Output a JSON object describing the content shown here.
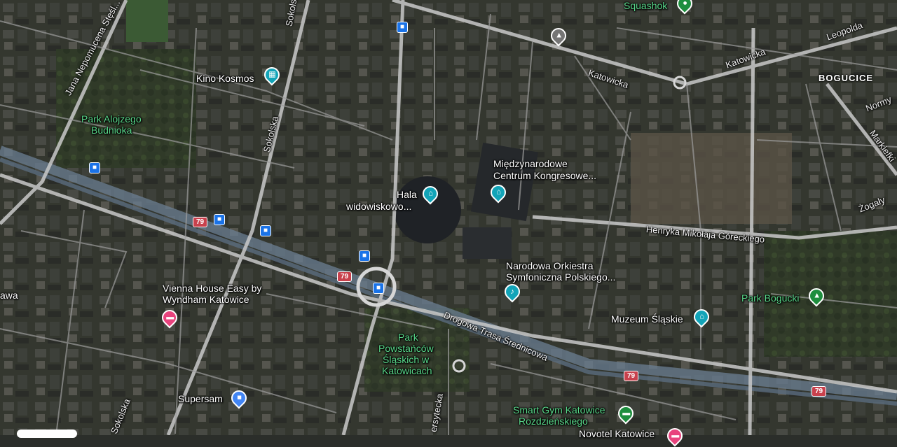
{
  "colors": {
    "teal_pin": "#12a4b8",
    "green_pin": "#1e8e3e",
    "pink_pin": "#e8437d",
    "gray_pin": "#757575",
    "blue_pin": "#4285f4",
    "route_shield": "#c8414d"
  },
  "pois": {
    "kino_kosmos": {
      "label": "Kino Kosmos",
      "icon": "film-icon"
    },
    "park_alojzego": {
      "label1": "Park Alojzego",
      "label2": "Budnioka"
    },
    "hala": {
      "label1": "Hala",
      "label2": "widowiskowo...",
      "icon": "museum-icon"
    },
    "centrum": {
      "label1": "Międzynarodowe",
      "label2": "Centrum Kongresowe...",
      "icon": "museum-icon"
    },
    "orkiestra": {
      "label1": "Narodowa Orkiestra",
      "label2": "Symfoniczna Polskiego...",
      "icon": "music-note-icon"
    },
    "vienna": {
      "label1": "Vienna House Easy by",
      "label2": "Wyndham Katowice",
      "icon": "bed-icon"
    },
    "park_powstancow": {
      "label1": "Park",
      "label2": "Powstańców",
      "label3": "Śląskich w",
      "label4": "Katowicach"
    },
    "muzeum": {
      "label": "Muzeum Śląskie",
      "icon": "museum-icon"
    },
    "park_bogucki": {
      "label": "Park Bogucki",
      "icon": "tree-icon"
    },
    "supersam": {
      "label": "Supersam",
      "icon": "shopping-bag-icon"
    },
    "smart_gym": {
      "label1": "Smart Gym Katowice",
      "label2": "Rozdzieńskiego",
      "icon": "dumbbell-icon"
    },
    "squashok": {
      "label": "Squashok"
    },
    "novotel": {
      "label": "Novotel Katowice"
    },
    "school": {
      "icon": "graduation-cap-icon"
    },
    "partial_left": {
      "label": "awa"
    }
  },
  "roads": {
    "jana": "Jana Nepomucena Stęśl...",
    "sokolska_top": "Sokolska",
    "sokolska_mid": "Sokolska",
    "sokolska_bottom": "Sokolska",
    "katowicka1": "Katowicka",
    "katowicka2": "Katowicka",
    "leopolda": "Leopolda",
    "normy": "Normy",
    "markiefki": "Markiefki",
    "zogaly": "Żogały",
    "goreckiego": "Henryka Mikołaja Góreckiego",
    "dts": "Drogowa Trasa Średnicowa",
    "uniwersytecka": "ersytecka"
  },
  "district": "BOGUCICE",
  "route_shields": [
    "79",
    "79",
    "79",
    "79"
  ]
}
